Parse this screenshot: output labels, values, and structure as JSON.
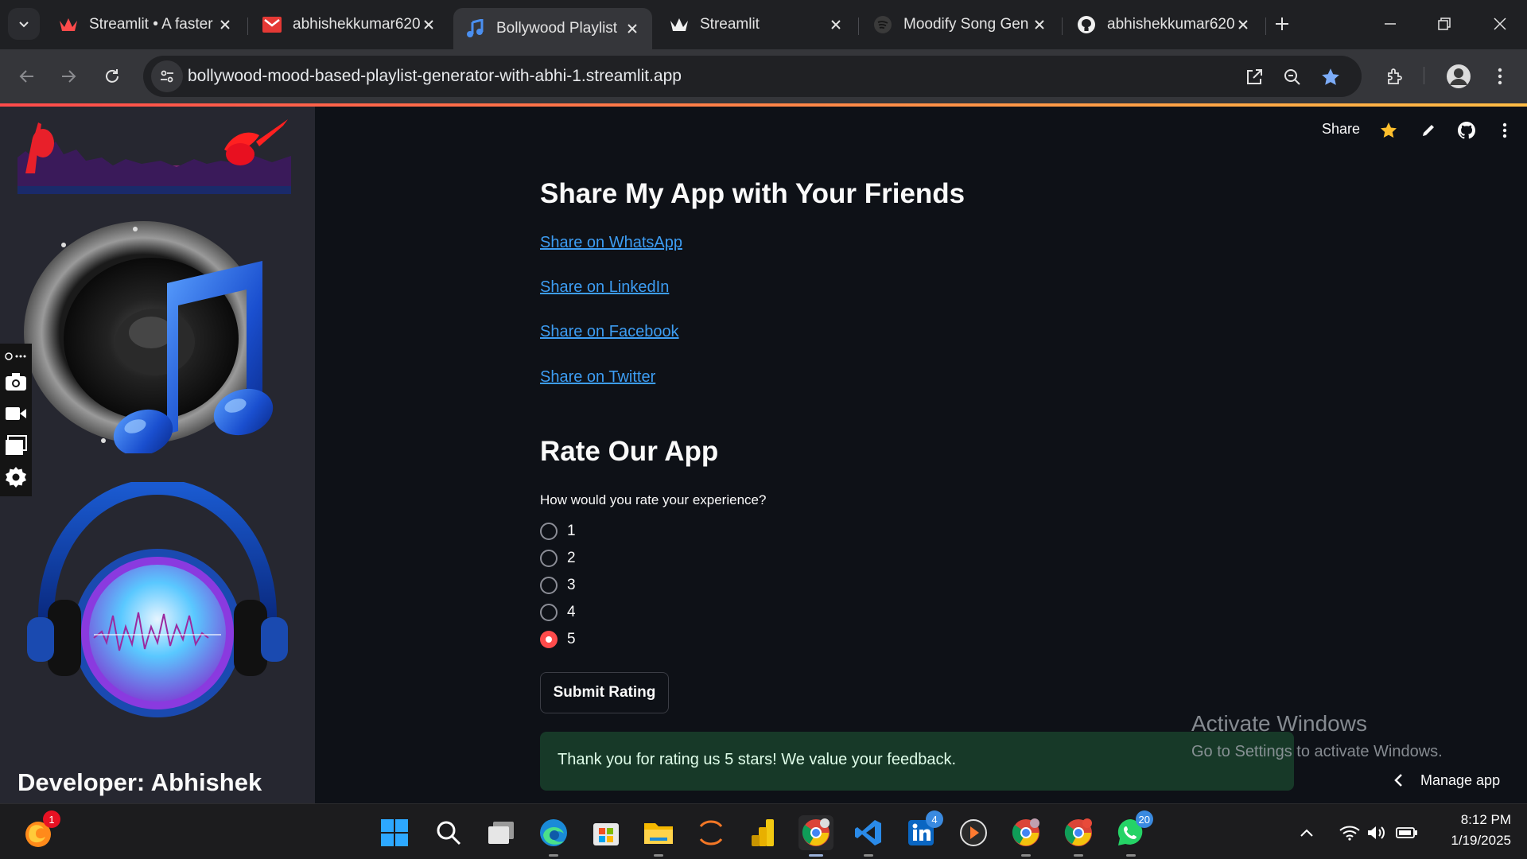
{
  "browser": {
    "tabs": [
      {
        "title": "Streamlit • A faster",
        "favicon": "streamlit-crown-icon",
        "active": false
      },
      {
        "title": "abhishekkumar620",
        "favicon": "gmail-icon",
        "active": false
      },
      {
        "title": "Bollywood Playlist",
        "favicon": "music-note-icon",
        "active": true
      },
      {
        "title": "Streamlit",
        "favicon": "streamlit-crown-icon",
        "active": false
      },
      {
        "title": "Moodify Song Gen",
        "favicon": "spotify-icon",
        "active": false
      },
      {
        "title": "abhishekkumar620",
        "favicon": "github-icon",
        "active": false
      }
    ],
    "url": "bollywood-mood-based-playlist-generator-with-abhi-1.streamlit.app"
  },
  "sidebar": {
    "developer_label": "Developer: Abhishek"
  },
  "header": {
    "share_label": "Share"
  },
  "share_section": {
    "title": "Share My App with Your Friends",
    "links": [
      "Share on WhatsApp",
      "Share on LinkedIn",
      "Share on Facebook",
      "Share on Twitter"
    ]
  },
  "rating_section": {
    "title": "Rate Our App",
    "question": "How would you rate your experience?",
    "options": [
      "1",
      "2",
      "3",
      "4",
      "5"
    ],
    "selected": "5",
    "submit_label": "Submit Rating",
    "success_message": "Thank you for rating us 5 stars! We value your feedback."
  },
  "watermark": {
    "line1": "Activate Windows",
    "line2": "Go to Settings to activate Windows."
  },
  "manage_app_label": "Manage app",
  "taskbar": {
    "badges": {
      "firefox": "1",
      "linkedin": "4",
      "whatsapp": "20"
    },
    "time": "8:12 PM",
    "date": "1/19/2025"
  },
  "colors": {
    "accent_red": "#ff4b4b",
    "link_blue": "#3d9df3",
    "success_bg": "#173928",
    "bg_main": "#0e1117",
    "bg_sidebar": "#262730"
  }
}
